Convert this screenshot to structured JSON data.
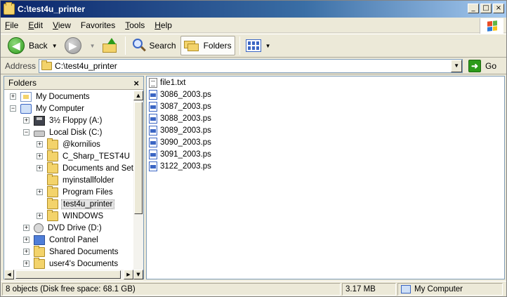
{
  "window": {
    "title": "C:\\test4u_printer"
  },
  "menubar": {
    "items": [
      {
        "accel": "F",
        "rest": "ile"
      },
      {
        "accel": "E",
        "rest": "dit"
      },
      {
        "accel": "V",
        "rest": "iew"
      },
      {
        "accel": "",
        "rest": "Favorites"
      },
      {
        "accel": "T",
        "rest": "ools"
      },
      {
        "accel": "H",
        "rest": "elp"
      }
    ]
  },
  "toolbar": {
    "back_label": "Back",
    "search_label": "Search",
    "folders_label": "Folders"
  },
  "address": {
    "label": "Address",
    "value": "C:\\test4u_printer",
    "go_label": "Go"
  },
  "folders_panel": {
    "title": "Folders",
    "close_glyph": "×",
    "items": [
      {
        "label": "My Documents",
        "expander": "+",
        "indent": 0,
        "icon": "documents-icon"
      },
      {
        "label": "My Computer",
        "expander": "−",
        "indent": 0,
        "icon": "my-computer-icon"
      },
      {
        "label": "3½ Floppy (A:)",
        "expander": "+",
        "indent": 1,
        "icon": "floppy-icon"
      },
      {
        "label": "Local Disk (C:)",
        "expander": "−",
        "indent": 1,
        "icon": "disk-icon"
      },
      {
        "label": "@kornilios",
        "expander": "+",
        "indent": 2,
        "icon": "folder-icon"
      },
      {
        "label": "C_Sharp_TEST4U",
        "expander": "+",
        "indent": 2,
        "icon": "folder-icon"
      },
      {
        "label": "Documents and Setti",
        "expander": "+",
        "indent": 2,
        "icon": "folder-icon"
      },
      {
        "label": "myinstallfolder",
        "expander": "",
        "indent": 2,
        "icon": "folder-icon"
      },
      {
        "label": "Program Files",
        "expander": "+",
        "indent": 2,
        "icon": "folder-icon"
      },
      {
        "label": "test4u_printer",
        "expander": "",
        "indent": 2,
        "icon": "folder-icon",
        "selected": true
      },
      {
        "label": "WINDOWS",
        "expander": "+",
        "indent": 2,
        "icon": "folder-icon"
      },
      {
        "label": "DVD Drive (D:)",
        "expander": "+",
        "indent": 1,
        "icon": "dvd-icon"
      },
      {
        "label": "Control Panel",
        "expander": "+",
        "indent": 1,
        "icon": "control-panel-icon"
      },
      {
        "label": "Shared Documents",
        "expander": "+",
        "indent": 1,
        "icon": "folder-icon"
      },
      {
        "label": "user4's Documents",
        "expander": "+",
        "indent": 1,
        "icon": "folder-icon"
      }
    ]
  },
  "files": [
    {
      "name": "file1.txt",
      "icon": "text-file-icon"
    },
    {
      "name": "3086_2003.ps",
      "icon": "ps-file-icon"
    },
    {
      "name": "3087_2003.ps",
      "icon": "ps-file-icon"
    },
    {
      "name": "3088_2003.ps",
      "icon": "ps-file-icon"
    },
    {
      "name": "3089_2003.ps",
      "icon": "ps-file-icon"
    },
    {
      "name": "3090_2003.ps",
      "icon": "ps-file-icon"
    },
    {
      "name": "3091_2003.ps",
      "icon": "ps-file-icon"
    },
    {
      "name": "3122_2003.ps",
      "icon": "ps-file-icon"
    }
  ],
  "status": {
    "summary": "8 objects (Disk free space: 68.1 GB)",
    "size": "3.17 MB",
    "location": "My Computer"
  }
}
